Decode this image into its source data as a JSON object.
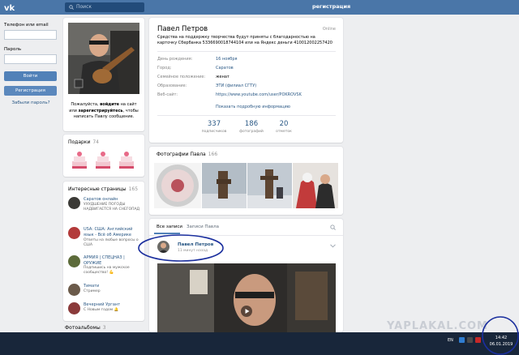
{
  "header": {
    "search_placeholder": "Поиск",
    "register_link": "регистрация"
  },
  "login": {
    "phone_label": "Телефон или email",
    "password_label": "Пароль",
    "login_button": "Войти",
    "register_button": "Регистрация",
    "forgot_link": "Забыли пароль?"
  },
  "avatar_card": {
    "caption_1": "Пожалуйста, ",
    "caption_login": "войдите",
    "caption_2": " на сайт или ",
    "caption_register": "зарегистрируйтесь",
    "caption_3": ", чтобы написать Павлу сообщение."
  },
  "gifts": {
    "title": "Подарки",
    "count": "74"
  },
  "pages": {
    "title": "Интересные страницы",
    "count": "165",
    "items": [
      {
        "name": "Саратов онлайн",
        "desc": "УХУДШЕНИЕ ПОГОДЫ НАДВИГАЕТСЯ НА СНЕГОПАД"
      },
      {
        "name": "USA: США: Английский язык - Всё об Америке",
        "desc": "Ответы на любые вопросы о США"
      },
      {
        "name": "АРМИЯ | СПЕЦНАЗ | ОРУЖИЕ",
        "desc": "Подпишись на мужское сообщество! 💪"
      },
      {
        "name": "Тимати",
        "desc": "Стример"
      },
      {
        "name": "Вечерний Ургант",
        "desc": "С Новым годом 🔔"
      }
    ]
  },
  "albums": {
    "title": "Фотоальбомы",
    "count": "3"
  },
  "profile": {
    "name": "Павел Петров",
    "online": "Online",
    "status": "Средства на поддержку творчества будут приняты с благодарностью на карточку Сбербанка 5336690018744104 или на Яндекс деньги 410012002257420",
    "rows": [
      {
        "k": "День рождения:",
        "v": "16 ноября",
        "link": true
      },
      {
        "k": "Город:",
        "v": "Саратов",
        "link": true
      },
      {
        "k": "Семейное положение:",
        "v": "женат",
        "link": false
      },
      {
        "k": "Образование:",
        "v": "ЭТИ (филиал СГТУ)",
        "link": true
      },
      {
        "k": "Веб-сайт:",
        "v": "https://www.youtube.com/user/POKROVSK",
        "link": true
      }
    ],
    "more": "Показать подробную информацию",
    "counters": [
      {
        "n": "337",
        "l": "подписчиков"
      },
      {
        "n": "186",
        "l": "фотографий"
      },
      {
        "n": "20",
        "l": "отметок"
      }
    ]
  },
  "photos": {
    "title": "Фотографии Павла",
    "count": "166"
  },
  "wall": {
    "tab_all": "Все записи",
    "tab_own": "Записи Павла",
    "post_author": "Павел Петров",
    "post_time": "11 минут назад"
  },
  "taskbar": {
    "lang": "EN",
    "time": "14:42",
    "date": "06.01.2019"
  },
  "watermark": "YAPLAKAL.COM",
  "colors": {
    "accent": "#4a76a8",
    "link": "#2a5885",
    "annotation": "#1b2f9e"
  }
}
